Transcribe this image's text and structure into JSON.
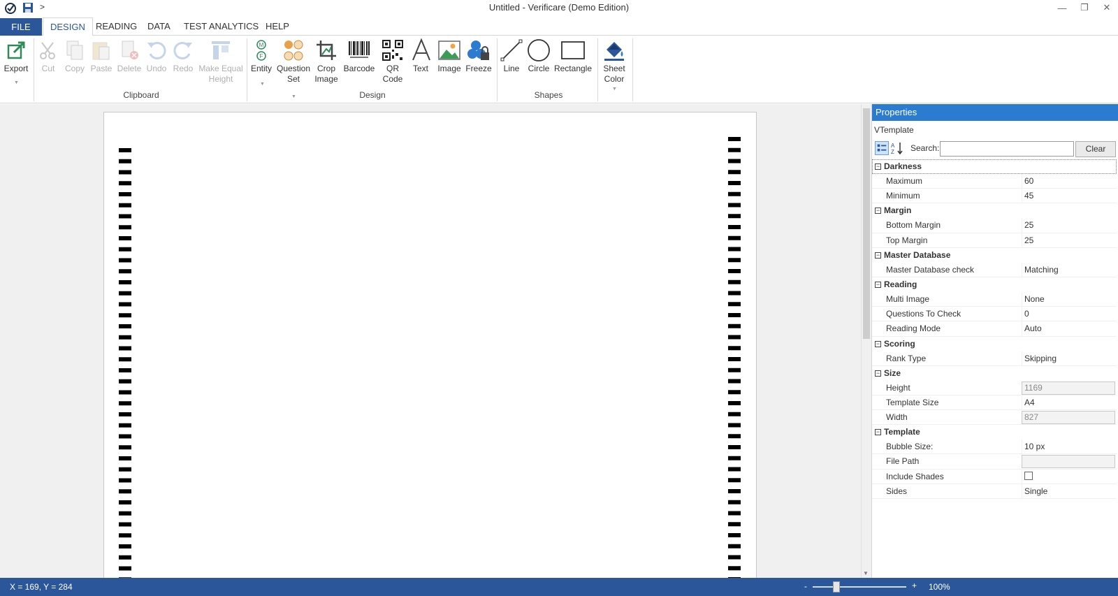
{
  "titlebar": {
    "title": "Untitled - Verificare (Demo Edition)",
    "quick_access_more": ">",
    "minimize": "—",
    "restore": "❐",
    "close": "✕"
  },
  "tabs": [
    {
      "label": "FILE"
    },
    {
      "label": "DESIGN"
    },
    {
      "label": "READING"
    },
    {
      "label": "DATA"
    },
    {
      "label": "TEST ANALYTICS"
    },
    {
      "label": "HELP"
    }
  ],
  "ribbon": {
    "export": {
      "line1": "Export"
    },
    "clipboard": {
      "label": "Clipboard",
      "cut": "Cut",
      "copy": "Copy",
      "paste": "Paste",
      "delete": "Delete",
      "undo": "Undo",
      "redo": "Redo",
      "make_equal_1": "Make Equal",
      "make_equal_2": "Height"
    },
    "design": {
      "label": "Design",
      "entity": "Entity",
      "question_1": "Question",
      "question_2": "Set",
      "crop_1": "Crop",
      "crop_2": "Image",
      "barcode": "Barcode",
      "qr_1": "QR",
      "qr_2": "Code",
      "text": "Text",
      "image": "Image",
      "freeze": "Freeze"
    },
    "shapes": {
      "label": "Shapes",
      "line": "Line",
      "circle": "Circle",
      "rectangle": "Rectangle"
    },
    "sheet_color_1": "Sheet",
    "sheet_color_2": "Color"
  },
  "properties": {
    "header": "Properties",
    "object": "VTemplate",
    "search_label": "Search:",
    "search_value": "",
    "clear_label": "Clear",
    "categories": [
      {
        "name": "Darkness",
        "rows": [
          {
            "name": "Maximum",
            "value": "60"
          },
          {
            "name": "Minimum",
            "value": "45"
          }
        ]
      },
      {
        "name": "Margin",
        "rows": [
          {
            "name": "Bottom Margin",
            "value": "25"
          },
          {
            "name": "Top Margin",
            "value": "25"
          }
        ]
      },
      {
        "name": "Master Database",
        "rows": [
          {
            "name": "Master Database check",
            "value": "Matching"
          }
        ]
      },
      {
        "name": "Reading",
        "rows": [
          {
            "name": "Multi Image",
            "value": "None"
          },
          {
            "name": "Questions To Check",
            "value": "0"
          },
          {
            "name": "Reading Mode",
            "value": "Auto"
          }
        ]
      },
      {
        "name": "Scoring",
        "rows": [
          {
            "name": "Rank Type",
            "value": "Skipping"
          }
        ]
      },
      {
        "name": "Size",
        "rows": [
          {
            "name": "Height",
            "value": "1169",
            "readonly": true
          },
          {
            "name": "Template Size",
            "value": "A4"
          },
          {
            "name": "Width",
            "value": "827",
            "readonly": true
          }
        ]
      },
      {
        "name": "Template",
        "rows": [
          {
            "name": "Bubble Size:",
            "value": "10 px"
          },
          {
            "name": "File Path",
            "value": "",
            "readonly": true
          },
          {
            "name": "Include Shades",
            "value": "",
            "checkbox": true,
            "checked": false
          },
          {
            "name": "Sides",
            "value": "Single"
          }
        ]
      }
    ]
  },
  "statusbar": {
    "coords": "X = 169, Y = 284",
    "zoom_minus": "-",
    "zoom_plus": "+",
    "zoom_level": "100%",
    "zoom_fraction": 0.25
  },
  "colors": {
    "accent": "#2b579a",
    "panel_header": "#2b7bd0",
    "workspace": "#f0f0f0"
  }
}
